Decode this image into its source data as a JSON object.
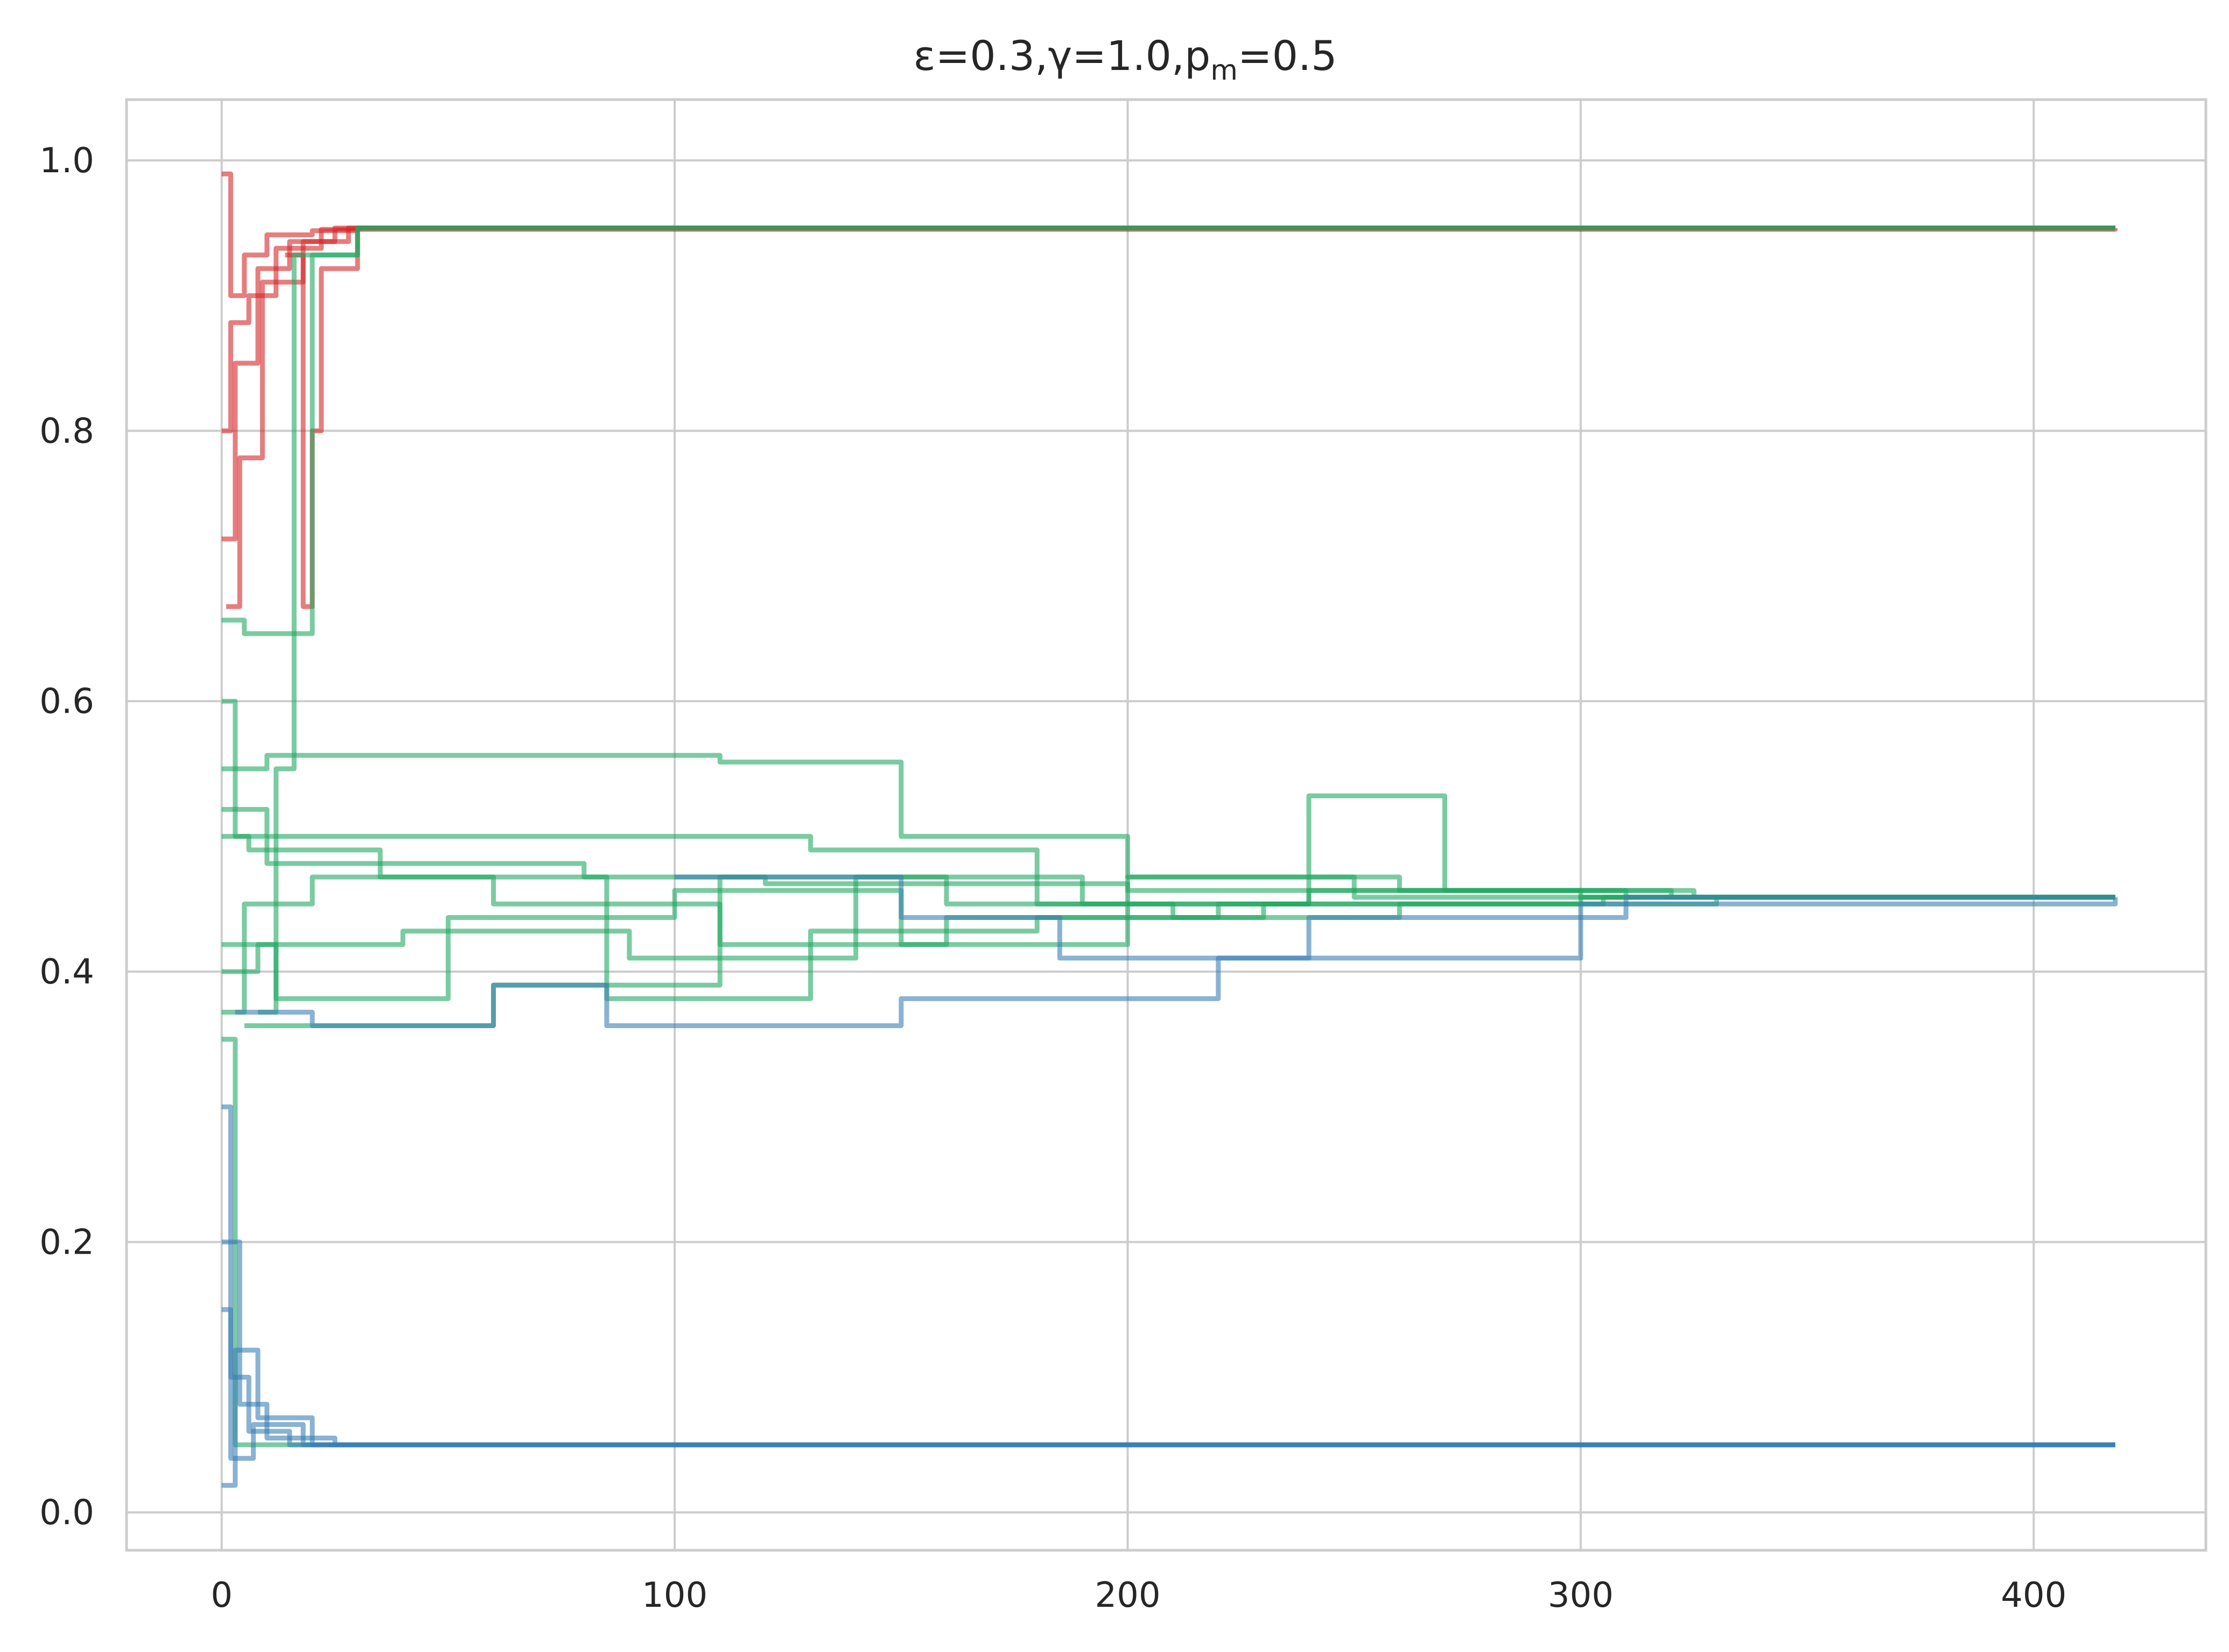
{
  "chart_data": {
    "type": "line",
    "title": {
      "main": "ε=0.3,γ=1.0,p",
      "sub": "m",
      "tail": "=0.5"
    },
    "xlabel": "",
    "ylabel": "",
    "xlim": [
      -21,
      438
    ],
    "ylim": [
      -0.028,
      1.045
    ],
    "xticks": [
      0,
      100,
      200,
      300,
      400
    ],
    "yticks": [
      0.0,
      0.2,
      0.4,
      0.6,
      0.8,
      1.0
    ],
    "xtick_labels": [
      "0",
      "100",
      "200",
      "300",
      "400"
    ],
    "ytick_labels": [
      "0.0",
      "0.2",
      "0.4",
      "0.6",
      "0.8",
      "1.0"
    ],
    "grid": true,
    "legend": "none",
    "colors": {
      "red": "#d62728",
      "green": "#22a862",
      "blue": "#3a7fb5",
      "grid": "#cccccc"
    },
    "series": [
      {
        "color": "red",
        "values": [
          [
            0,
            0.99
          ],
          [
            2,
            0.9
          ],
          [
            5,
            0.93
          ],
          [
            10,
            0.945
          ],
          [
            20,
            0.948
          ],
          [
            30,
            0.95
          ],
          [
            418,
            0.95
          ]
        ]
      },
      {
        "color": "red",
        "values": [
          [
            0,
            0.72
          ],
          [
            3,
            0.85
          ],
          [
            8,
            0.92
          ],
          [
            15,
            0.94
          ],
          [
            25,
            0.95
          ],
          [
            418,
            0.95
          ]
        ]
      },
      {
        "color": "red",
        "values": [
          [
            0,
            0.8
          ],
          [
            2,
            0.88
          ],
          [
            6,
            0.9
          ],
          [
            12,
            0.935
          ],
          [
            22,
            0.949
          ],
          [
            418,
            0.95
          ]
        ]
      },
      {
        "color": "red",
        "values": [
          [
            1,
            0.67
          ],
          [
            4,
            0.78
          ],
          [
            9,
            0.91
          ],
          [
            18,
            0.94
          ],
          [
            28,
            0.95
          ],
          [
            418,
            0.95
          ]
        ]
      },
      {
        "color": "red",
        "values": [
          [
            14,
            0.93
          ],
          [
            18,
            0.67
          ],
          [
            20,
            0.8
          ],
          [
            22,
            0.92
          ],
          [
            30,
            0.95
          ],
          [
            418,
            0.95
          ]
        ]
      },
      {
        "color": "green",
        "values": [
          [
            0,
            0.6
          ],
          [
            3,
            0.5
          ],
          [
            10,
            0.48
          ],
          [
            40,
            0.48
          ],
          [
            80,
            0.47
          ],
          [
            120,
            0.465
          ],
          [
            200,
            0.46
          ],
          [
            300,
            0.455
          ],
          [
            418,
            0.455
          ]
        ]
      },
      {
        "color": "green",
        "values": [
          [
            0,
            0.37
          ],
          [
            5,
            0.45
          ],
          [
            20,
            0.47
          ],
          [
            60,
            0.45
          ],
          [
            110,
            0.42
          ],
          [
            160,
            0.44
          ],
          [
            220,
            0.45
          ],
          [
            300,
            0.455
          ],
          [
            418,
            0.455
          ]
        ]
      },
      {
        "color": "green",
        "values": [
          [
            0,
            0.55
          ],
          [
            10,
            0.56
          ],
          [
            60,
            0.56
          ],
          [
            110,
            0.555
          ],
          [
            150,
            0.5
          ],
          [
            200,
            0.47
          ],
          [
            260,
            0.46
          ],
          [
            320,
            0.455
          ],
          [
            418,
            0.455
          ]
        ]
      },
      {
        "color": "green",
        "values": [
          [
            0,
            0.4
          ],
          [
            8,
            0.42
          ],
          [
            40,
            0.43
          ],
          [
            90,
            0.41
          ],
          [
            140,
            0.47
          ],
          [
            190,
            0.45
          ],
          [
            240,
            0.46
          ],
          [
            310,
            0.455
          ],
          [
            418,
            0.455
          ]
        ]
      },
      {
        "color": "green",
        "values": [
          [
            0,
            0.5
          ],
          [
            6,
            0.49
          ],
          [
            35,
            0.47
          ],
          [
            85,
            0.38
          ],
          [
            130,
            0.43
          ],
          [
            180,
            0.44
          ],
          [
            230,
            0.45
          ],
          [
            305,
            0.455
          ],
          [
            418,
            0.455
          ]
        ]
      },
      {
        "color": "green",
        "values": [
          [
            0,
            0.42
          ],
          [
            12,
            0.38
          ],
          [
            50,
            0.44
          ],
          [
            100,
            0.46
          ],
          [
            150,
            0.42
          ],
          [
            200,
            0.47
          ],
          [
            250,
            0.455
          ],
          [
            315,
            0.455
          ],
          [
            418,
            0.455
          ]
        ]
      },
      {
        "color": "green",
        "values": [
          [
            5,
            0.36
          ],
          [
            15,
            0.36
          ],
          [
            60,
            0.39
          ],
          [
            110,
            0.47
          ],
          [
            160,
            0.45
          ],
          [
            210,
            0.44
          ],
          [
            260,
            0.45
          ],
          [
            330,
            0.455
          ],
          [
            418,
            0.455
          ]
        ]
      },
      {
        "color": "green",
        "values": [
          [
            0,
            0.52
          ],
          [
            10,
            0.5
          ],
          [
            70,
            0.5
          ],
          [
            130,
            0.49
          ],
          [
            180,
            0.45
          ],
          [
            240,
            0.53
          ],
          [
            270,
            0.46
          ],
          [
            325,
            0.455
          ],
          [
            418,
            0.455
          ]
        ]
      },
      {
        "color": "green",
        "values": [
          [
            0,
            0.66
          ],
          [
            5,
            0.65
          ],
          [
            15,
            0.65
          ],
          [
            20,
            0.93
          ],
          [
            30,
            0.95
          ],
          [
            418,
            0.95
          ]
        ]
      },
      {
        "color": "green",
        "values": [
          [
            0,
            0.35
          ],
          [
            3,
            0.05
          ],
          [
            20,
            0.05
          ],
          [
            418,
            0.05
          ]
        ]
      },
      {
        "color": "green",
        "values": [
          [
            8,
            0.37
          ],
          [
            12,
            0.55
          ],
          [
            16,
            0.93
          ],
          [
            30,
            0.95
          ],
          [
            418,
            0.95
          ]
        ]
      },
      {
        "color": "blue",
        "values": [
          [
            0,
            0.3
          ],
          [
            2,
            0.1
          ],
          [
            6,
            0.06
          ],
          [
            15,
            0.05
          ],
          [
            418,
            0.05
          ]
        ]
      },
      {
        "color": "blue",
        "values": [
          [
            0,
            0.02
          ],
          [
            3,
            0.12
          ],
          [
            8,
            0.07
          ],
          [
            20,
            0.05
          ],
          [
            418,
            0.05
          ]
        ]
      },
      {
        "color": "blue",
        "values": [
          [
            0,
            0.2
          ],
          [
            4,
            0.08
          ],
          [
            10,
            0.055
          ],
          [
            25,
            0.05
          ],
          [
            418,
            0.05
          ]
        ]
      },
      {
        "color": "blue",
        "values": [
          [
            0,
            0.15
          ],
          [
            2,
            0.04
          ],
          [
            7,
            0.065
          ],
          [
            18,
            0.05
          ],
          [
            418,
            0.05
          ]
        ]
      },
      {
        "color": "blue",
        "values": [
          [
            3,
            0.37
          ],
          [
            20,
            0.36
          ],
          [
            60,
            0.39
          ],
          [
            85,
            0.36
          ],
          [
            150,
            0.38
          ],
          [
            220,
            0.41
          ],
          [
            300,
            0.45
          ],
          [
            418,
            0.455
          ]
        ]
      },
      {
        "color": "blue",
        "values": [
          [
            100,
            0.47
          ],
          [
            150,
            0.44
          ],
          [
            185,
            0.41
          ],
          [
            240,
            0.44
          ],
          [
            310,
            0.455
          ],
          [
            418,
            0.455
          ]
        ]
      }
    ]
  }
}
